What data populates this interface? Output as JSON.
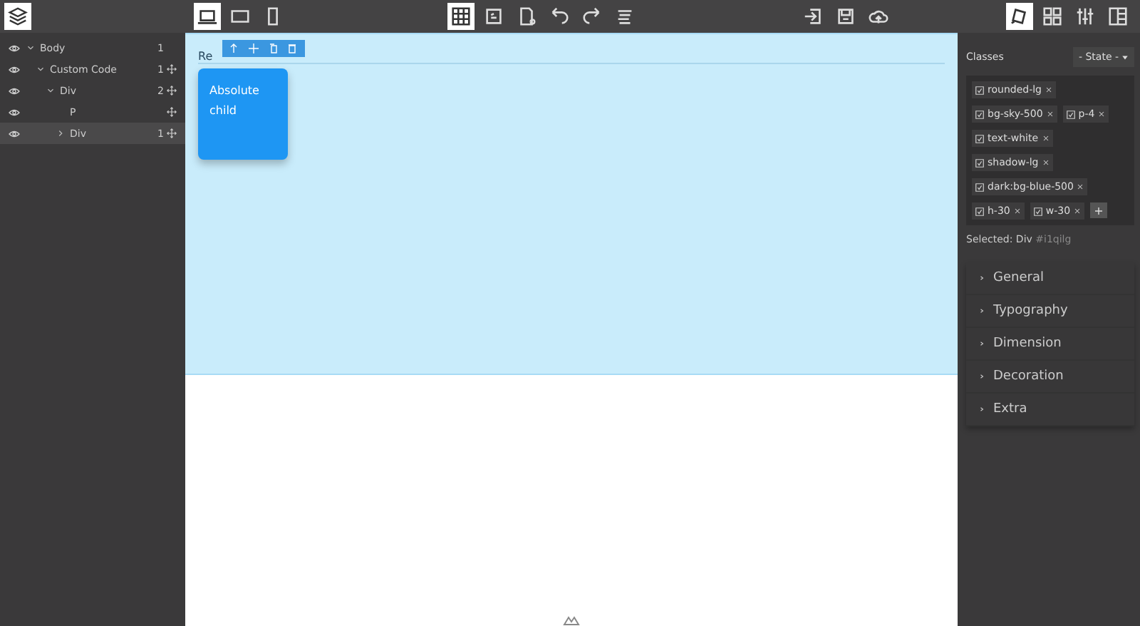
{
  "device_buttons": [
    {
      "kind": "desktop",
      "selected": true
    },
    {
      "kind": "tablet",
      "selected": false
    },
    {
      "kind": "mobile",
      "selected": false
    }
  ],
  "canvas_tools": [
    {
      "kind": "grid",
      "selected": true
    },
    {
      "kind": "code",
      "selected": false
    },
    {
      "kind": "file",
      "selected": false
    },
    {
      "kind": "undo",
      "selected": false
    },
    {
      "kind": "redo",
      "selected": false
    },
    {
      "kind": "lines",
      "selected": false
    }
  ],
  "file_tools": [
    {
      "kind": "import"
    },
    {
      "kind": "save"
    },
    {
      "kind": "cloud"
    }
  ],
  "panel_tabs": [
    {
      "kind": "style",
      "selected": true
    },
    {
      "kind": "blocks",
      "selected": false
    },
    {
      "kind": "settings",
      "selected": false
    },
    {
      "kind": "layers",
      "selected": false
    }
  ],
  "layers": [
    {
      "name": "Body",
      "count": "1",
      "visible": true,
      "expanded": true,
      "selected": false,
      "movable": false,
      "children": [
        {
          "name": "Custom Code",
          "count": "1",
          "visible": true,
          "expanded": true,
          "selected": false,
          "movable": true,
          "children": [
            {
              "name": "Div",
              "count": "2",
              "visible": true,
              "expanded": true,
              "selected": false,
              "movable": true,
              "children": [
                {
                  "name": "P",
                  "visible": true,
                  "selected": false,
                  "movable": true
                },
                {
                  "name": "Div",
                  "count": "1",
                  "visible": true,
                  "expanded": false,
                  "selected": true,
                  "movable": true
                }
              ]
            }
          ]
        }
      ]
    }
  ],
  "canvas": {
    "heading": "Re",
    "toolbar": [
      {
        "kind": "up"
      },
      {
        "kind": "move"
      },
      {
        "kind": "copy"
      },
      {
        "kind": "delete"
      }
    ],
    "box_text": "Absolute child"
  },
  "classes": {
    "label": "Classes",
    "state": "- State -",
    "tags": [
      {
        "name": "rounded-lg",
        "checked": true
      },
      {
        "name": "bg-sky-500",
        "checked": true
      },
      {
        "name": "p-4",
        "checked": true
      },
      {
        "name": "text-white",
        "checked": true
      },
      {
        "name": "shadow-lg",
        "checked": true
      },
      {
        "name": "dark:bg-blue-500",
        "checked": true
      },
      {
        "name": "h-30",
        "checked": true
      },
      {
        "name": "w-30",
        "checked": true
      }
    ],
    "selected_label": "Selected:",
    "selected_name": "Div",
    "selected_id": "#i1qilg"
  },
  "sections": [
    {
      "title": "General",
      "expanded": false
    },
    {
      "title": "Typography",
      "expanded": false
    },
    {
      "title": "Dimension",
      "expanded": false
    },
    {
      "title": "Decoration",
      "expanded": false
    },
    {
      "title": "Extra",
      "expanded": false
    }
  ]
}
